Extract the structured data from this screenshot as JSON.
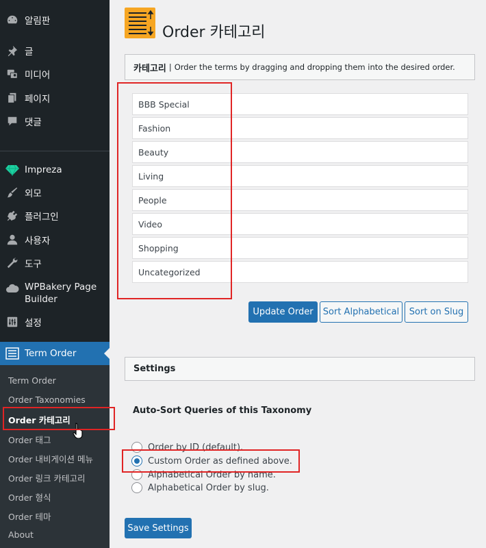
{
  "sidebar": {
    "menu": [
      {
        "label": "알림판",
        "icon": "dashboard-icon"
      },
      {
        "label": "글",
        "icon": "pin-icon"
      },
      {
        "label": "미디어",
        "icon": "media-icon"
      },
      {
        "label": "페이지",
        "icon": "page-icon"
      },
      {
        "label": "댓글",
        "icon": "comment-icon"
      },
      {
        "label": "Impreza",
        "icon": "diamond-icon"
      },
      {
        "label": "외모",
        "icon": "brush-icon"
      },
      {
        "label": "플러그인",
        "icon": "plugin-icon"
      },
      {
        "label": "사용자",
        "icon": "user-icon"
      },
      {
        "label": "도구",
        "icon": "wrench-icon"
      },
      {
        "label": "WPBakery Page Builder",
        "label_line1": "WPBakery Page",
        "label_line2": "Builder",
        "icon": "cloud-icon"
      },
      {
        "label": "설정",
        "icon": "settings-icon"
      }
    ],
    "active": {
      "label": "Term Order",
      "icon": "list-icon"
    },
    "submenu": [
      {
        "label": "Term Order"
      },
      {
        "label": "Order Taxonomies"
      },
      {
        "label": "Order 카테고리",
        "current": true
      },
      {
        "label": "Order 태그"
      },
      {
        "label": "Order 내비게이션 메뉴"
      },
      {
        "label": "Order 링크 카테고리"
      },
      {
        "label": "Order 형식"
      },
      {
        "label": "Order 테마"
      },
      {
        "label": "About"
      }
    ]
  },
  "main": {
    "title": "Order 카테고리",
    "category_panel": {
      "heading": "카테고리",
      "separator": "|",
      "description": "Order the terms by dragging and dropping them into the desired order."
    },
    "terms": [
      "BBB Special",
      "Fashion",
      "Beauty",
      "Living",
      "People",
      "Video",
      "Shopping",
      "Uncategorized"
    ],
    "buttons": {
      "update": "Update Order",
      "sort_alpha": "Sort Alphabetical",
      "sort_slug": "Sort on Slug"
    },
    "settings": {
      "heading": "Settings",
      "auto_sort_label": "Auto-Sort Queries of this Taxonomy",
      "options": [
        {
          "label": "Order by ID (default).",
          "checked": false
        },
        {
          "label": "Custom Order as defined above.",
          "checked": true
        },
        {
          "label": "Alphabetical Order by name.",
          "checked": false
        },
        {
          "label": "Alphabetical Order by slug.",
          "checked": false
        }
      ],
      "save_label": "Save Settings"
    }
  },
  "colors": {
    "sidebar_bg": "#1d2327",
    "accent": "#2271b1",
    "highlight": "#e02424",
    "title_icon": "#f6a623"
  }
}
